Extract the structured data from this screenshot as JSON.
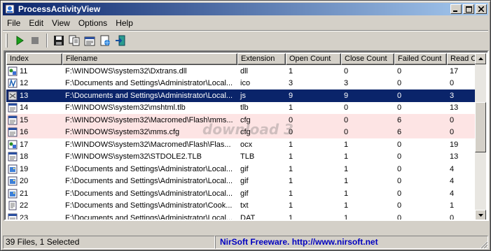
{
  "window": {
    "title": "ProcessActivityView"
  },
  "menu": [
    "File",
    "Edit",
    "View",
    "Options",
    "Help"
  ],
  "toolbar": {
    "buttons": [
      "play-icon",
      "stop-icon",
      "save-icon",
      "copy-icon",
      "properties-icon",
      "html-report-icon",
      "exit-icon"
    ]
  },
  "table": {
    "columns": [
      "Index",
      "Filename",
      "Extension",
      "Open Count",
      "Close Count",
      "Failed Count",
      "Read Co"
    ],
    "rows": [
      {
        "index": "11",
        "filename": "F:\\WINDOWS\\system32\\Dxtrans.dll",
        "ext": "dll",
        "open": "1",
        "close": "0",
        "failed": "0",
        "read": "17",
        "state": "normal",
        "icon": "dll-icon"
      },
      {
        "index": "12",
        "filename": "F:\\Documents and Settings\\Administrator\\Local...",
        "ext": "ico",
        "open": "3",
        "close": "3",
        "failed": "0",
        "read": "0",
        "state": "normal",
        "icon": "ico-file-icon"
      },
      {
        "index": "13",
        "filename": "F:\\Documents and Settings\\Administrator\\Local...",
        "ext": "js",
        "open": "9",
        "close": "9",
        "failed": "0",
        "read": "3",
        "state": "selected",
        "icon": "js-file-icon"
      },
      {
        "index": "14",
        "filename": "F:\\WINDOWS\\system32\\mshtml.tlb",
        "ext": "tlb",
        "open": "1",
        "close": "0",
        "failed": "0",
        "read": "13",
        "state": "normal",
        "icon": "file-icon"
      },
      {
        "index": "15",
        "filename": "F:\\WINDOWS\\system32\\Macromed\\Flash\\mms...",
        "ext": "cfg",
        "open": "0",
        "close": "0",
        "failed": "6",
        "read": "0",
        "state": "failed",
        "icon": "file-icon"
      },
      {
        "index": "16",
        "filename": "F:\\WINDOWS\\system32\\mms.cfg",
        "ext": "cfg",
        "open": "0",
        "close": "0",
        "failed": "6",
        "read": "0",
        "state": "failed",
        "icon": "file-icon"
      },
      {
        "index": "17",
        "filename": "F:\\WINDOWS\\system32\\Macromed\\Flash\\Flas...",
        "ext": "ocx",
        "open": "1",
        "close": "1",
        "failed": "0",
        "read": "19",
        "state": "normal",
        "icon": "dll-icon"
      },
      {
        "index": "18",
        "filename": "F:\\WINDOWS\\system32\\STDOLE2.TLB",
        "ext": "TLB",
        "open": "1",
        "close": "1",
        "failed": "0",
        "read": "13",
        "state": "normal",
        "icon": "file-icon"
      },
      {
        "index": "19",
        "filename": "F:\\Documents and Settings\\Administrator\\Local...",
        "ext": "gif",
        "open": "1",
        "close": "1",
        "failed": "0",
        "read": "4",
        "state": "normal",
        "icon": "image-file-icon"
      },
      {
        "index": "20",
        "filename": "F:\\Documents and Settings\\Administrator\\Local...",
        "ext": "gif",
        "open": "1",
        "close": "1",
        "failed": "0",
        "read": "4",
        "state": "normal",
        "icon": "image-file-icon"
      },
      {
        "index": "21",
        "filename": "F:\\Documents and Settings\\Administrator\\Local...",
        "ext": "gif",
        "open": "1",
        "close": "1",
        "failed": "0",
        "read": "4",
        "state": "normal",
        "icon": "image-file-icon"
      },
      {
        "index": "22",
        "filename": "F:\\Documents and Settings\\Administrator\\Cook...",
        "ext": "txt",
        "open": "1",
        "close": "1",
        "failed": "0",
        "read": "1",
        "state": "normal",
        "icon": "text-file-icon"
      },
      {
        "index": "23",
        "filename": "F:\\Documents and Settings\\Administrator\\Local...",
        "ext": "DAT",
        "open": "1",
        "close": "1",
        "failed": "0",
        "read": "0",
        "state": "normal",
        "icon": "file-icon"
      }
    ]
  },
  "watermark": "download 3",
  "status": {
    "summary": "39 Files, 1 Selected",
    "link": "NirSoft Freeware.  http://www.nirsoft.net"
  },
  "colors": {
    "selection": "#0a246a",
    "failed_row": "#fde4e4",
    "titlebar": "#0a246a",
    "link": "#0000c0"
  }
}
